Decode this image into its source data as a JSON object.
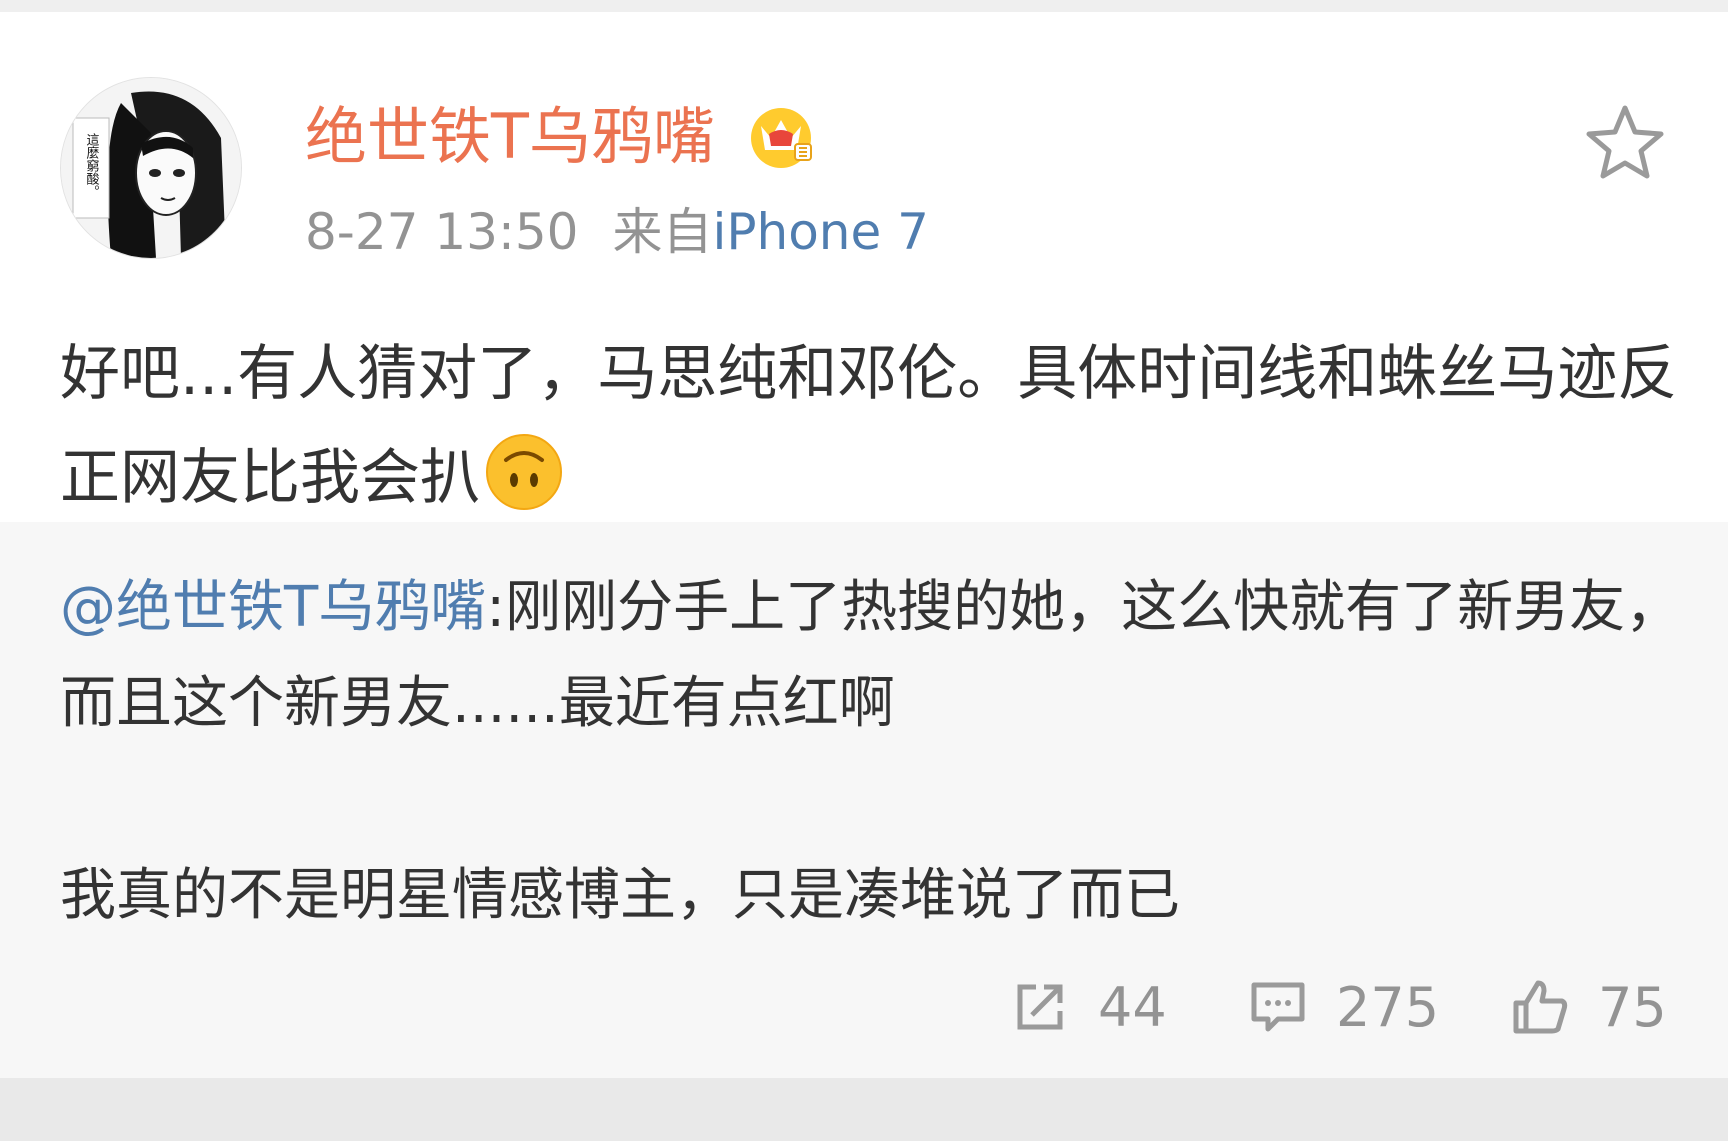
{
  "post": {
    "username": "绝世铁T乌鸦嘴",
    "avatar_text": "這麼窮酸。",
    "time": "8-27 13:50",
    "from_label": "来自",
    "device": "iPhone 7",
    "text": "好吧...有人猜对了，马思纯和邓伦。具体时间线和蛛丝马迹反正网友比我会扒",
    "emoji": "upside-down-face-emoji"
  },
  "repost": {
    "mention": "@绝世铁T乌鸦嘴",
    "text_part1": ":刚刚分手上了热搜的她，这么快就有了新男友，而且这个新男友......最近有点红啊",
    "text_part2": "我真的不是明星情感博主，只是凑堆说了而已",
    "share_count": "44",
    "comment_count": "275",
    "like_count": "75"
  },
  "colors": {
    "username": "#eb7350",
    "link": "#507daf",
    "meta": "#939393",
    "repost_bg": "#f7f7f7"
  }
}
